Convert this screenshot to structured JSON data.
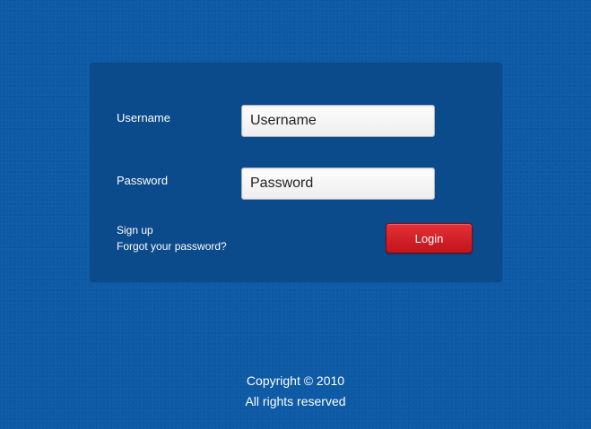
{
  "login_form": {
    "username_label": "Username",
    "username_placeholder": "Username",
    "password_label": "Password",
    "password_placeholder": "Password",
    "signup_link": "Sign up",
    "forgot_link": "Forgot your password?",
    "login_button": "Login"
  },
  "footer": {
    "copyright": "Copyright © 2010",
    "rights": "All rights reserved"
  },
  "colors": {
    "page_background": "#0d5aa6",
    "panel_background": "#0b4a8b",
    "login_button": "#d11f26"
  }
}
